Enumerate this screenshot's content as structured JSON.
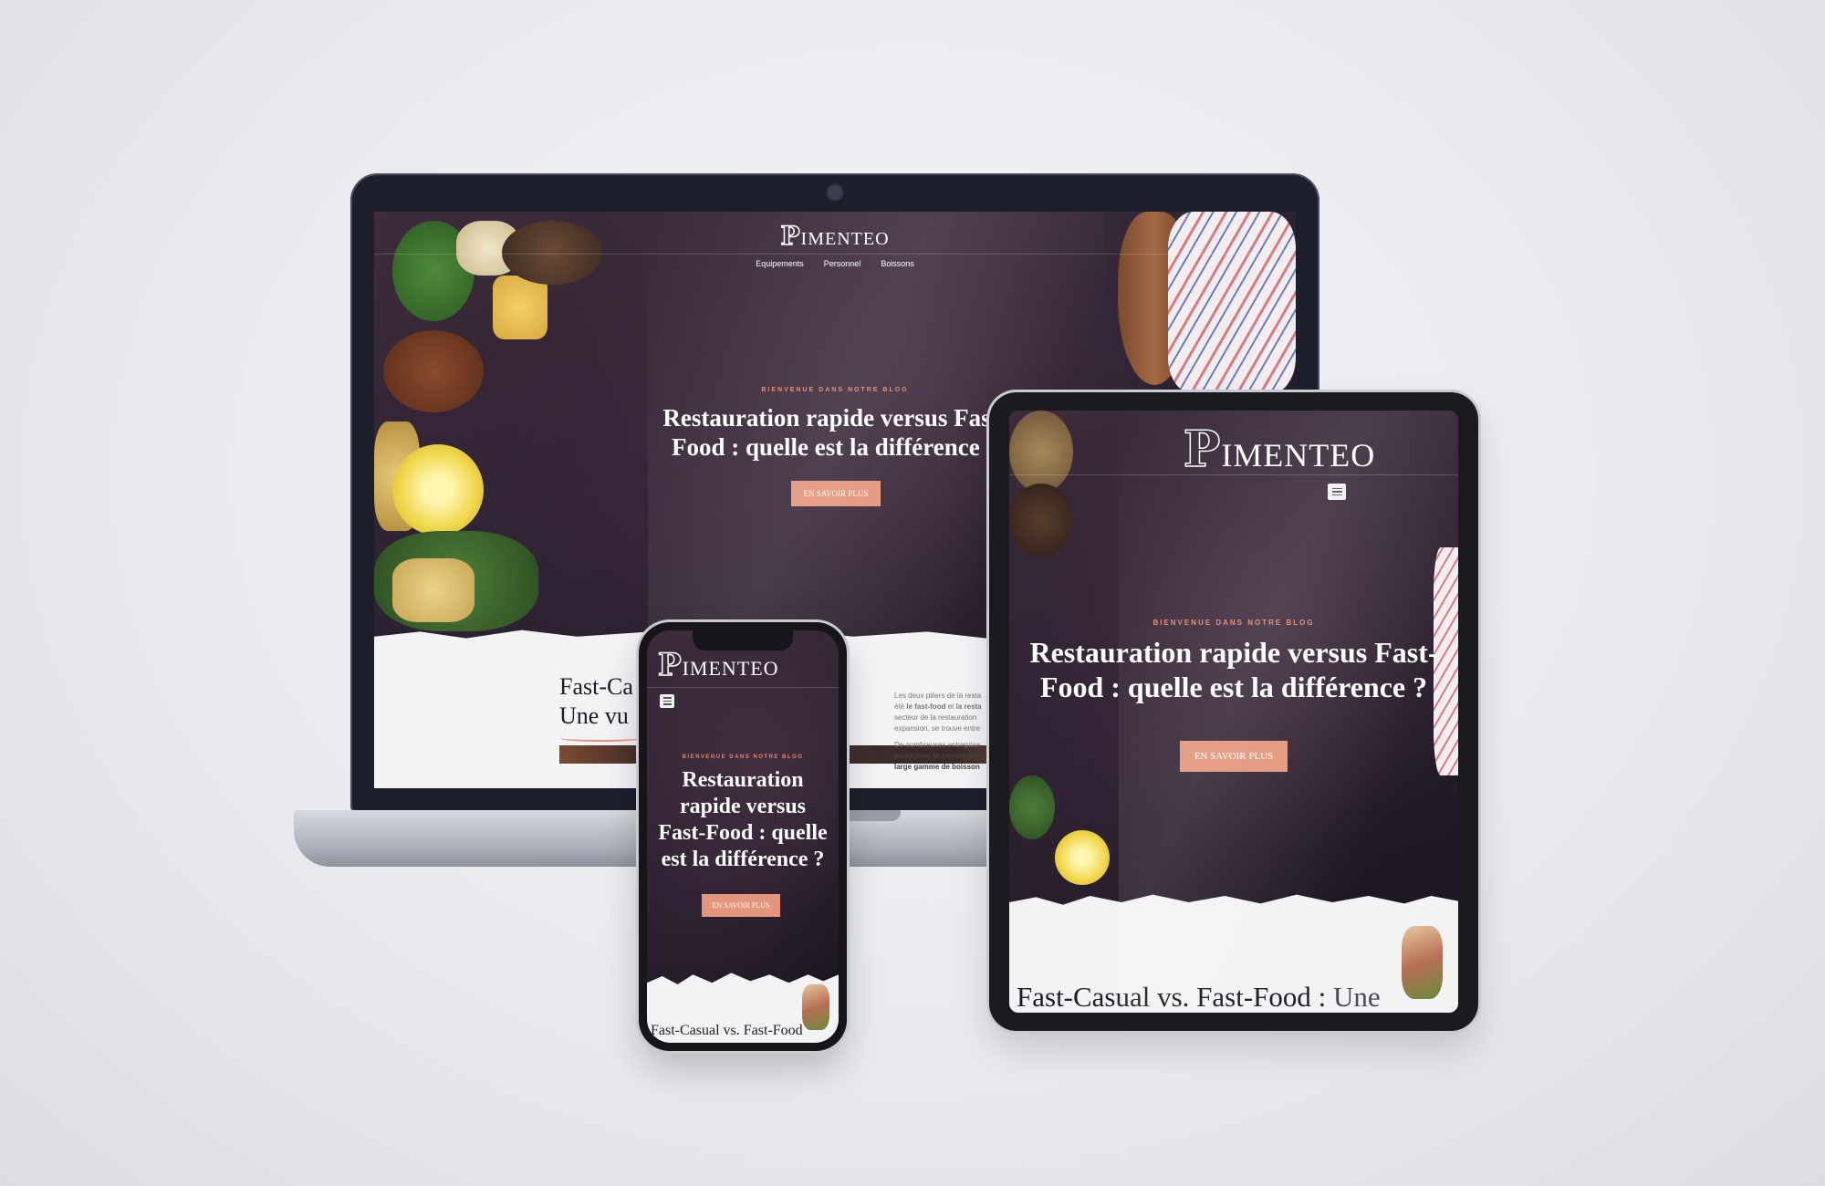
{
  "brand": {
    "letter": "P",
    "rest": "IMENTEO"
  },
  "nav": {
    "items": [
      "Equipements",
      "Personnel",
      "Boissons"
    ]
  },
  "hero": {
    "eyebrow": "BIENVENUE DANS NOTRE BLOG",
    "laptop_headline_1": "Restauration rapide versus Fast-",
    "laptop_headline_2": "Food : quelle est la différence ?",
    "tablet_headline_1": "Restauration rapide versus Fast-",
    "tablet_headline_2": "Food : quelle est la différence ?",
    "phone_headline_1": "Restauration",
    "phone_headline_2": "rapide versus",
    "phone_headline_3": "Fast-Food : quelle",
    "phone_headline_4": "est la différence ?",
    "cta": "EN SAVOIR PLUS"
  },
  "article": {
    "laptop_title_1": "Fast-Ca",
    "laptop_title_2": "Une vu",
    "tablet_title_a": "Fast-Casual vs. Fast-Food :",
    "tablet_title_b": "Une",
    "phone_title": "Fast-Casual vs. Fast-Food",
    "excerpt_1": "Les deux piliers de la resta",
    "excerpt_2a": "été",
    "excerpt_2b": "le fast-food",
    "excerpt_2c": "et",
    "excerpt_2d": "la resta",
    "excerpt_3": "secteur de la restauration",
    "excerpt_4": "expansion, se trouve entre",
    "excerpt_5": "De nombreuses entreprise",
    "excerpt_6": "sains avec la commodité,",
    "excerpt_7": "large gamme de boisson"
  },
  "colors": {
    "accent": "#e3967b",
    "eyebrow": "#e08a6f",
    "hero_bg": "#2b2330"
  }
}
